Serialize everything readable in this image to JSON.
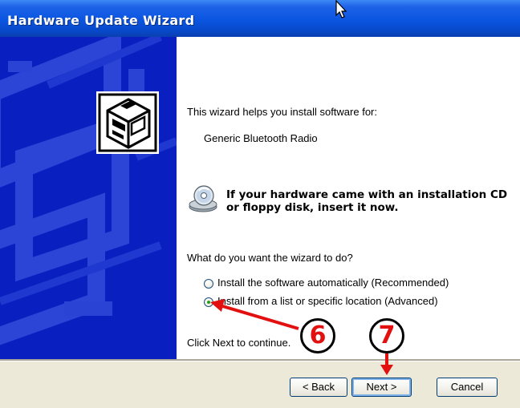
{
  "window": {
    "title": "Hardware Update Wizard"
  },
  "content": {
    "intro": "This wizard helps you install software for:",
    "device_name": "Generic Bluetooth Radio",
    "cd_notice_line1": "If your hardware came with an installation CD",
    "cd_notice_line2": "or floppy disk, insert it now.",
    "question": "What do you want the wizard to do?",
    "options": [
      {
        "label": "Install the software automatically (Recommended)",
        "selected": false
      },
      {
        "label": "Install from a list or specific location (Advanced)",
        "selected": true
      }
    ],
    "footer_hint": "Click Next to continue."
  },
  "buttons": {
    "back": "< Back",
    "next": "Next >",
    "cancel": "Cancel"
  },
  "annotations": {
    "step6": "6",
    "step7": "7",
    "color": "#e31010"
  },
  "icons": [
    "hardware-icon",
    "cd-icon",
    "cursor-icon"
  ]
}
